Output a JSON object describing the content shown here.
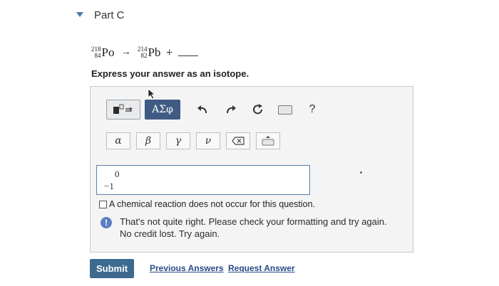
{
  "part": {
    "title": "Part C"
  },
  "equation": {
    "reactant": {
      "mass": "218",
      "atomic": "84",
      "symbol": "Po"
    },
    "arrow": "→",
    "product": {
      "mass": "214",
      "atomic": "82",
      "symbol": "Pb"
    },
    "plus": "+"
  },
  "instruction": "Express your answer as an isotope.",
  "toolbar": {
    "greek_label": "ΑΣφ",
    "help_label": "?",
    "symbols": [
      "α",
      "β",
      "γ",
      "ν"
    ]
  },
  "answer": {
    "top_value": "0",
    "bottom_value": "−1"
  },
  "no_reaction_label": "A chemical reaction does not occur for this question.",
  "feedback": {
    "line1": "That's not quite right. Please check your formatting and try again.",
    "line2": "No credit lost. Try again."
  },
  "buttons": {
    "submit": "Submit",
    "previous_answers": "Previous Answers",
    "request_answer": "Request Answer"
  },
  "colors": {
    "accent": "#3f5a83",
    "submit": "#3d6a8e",
    "link": "#2a4a88",
    "info": "#5b7fc4"
  }
}
